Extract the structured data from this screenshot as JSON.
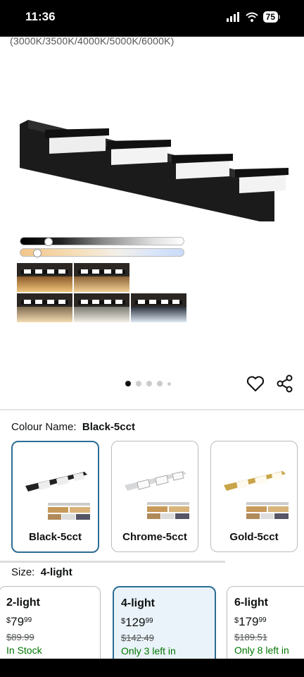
{
  "status": {
    "time": "11:36",
    "battery": "75"
  },
  "product": {
    "spec_text": "(3000K/3500K/4000K/5000K/6000K)"
  },
  "gallery": {
    "total_dots": 5,
    "active_index": 0
  },
  "colour": {
    "label": "Colour Name:",
    "selected": "Black-5cct",
    "options": [
      {
        "name": "Black-5cct"
      },
      {
        "name": "Chrome-5cct"
      },
      {
        "name": "Gold-5cct"
      }
    ]
  },
  "size": {
    "label": "Size:",
    "selected": "4-light",
    "options": [
      {
        "name": "2-light",
        "currency": "$",
        "whole": "79",
        "fraction": "99",
        "was": "$89.99",
        "stock": "In Stock"
      },
      {
        "name": "4-light",
        "currency": "$",
        "whole": "129",
        "fraction": "99",
        "was": "$142.49",
        "stock": "Only 3 left in"
      },
      {
        "name": "6-light",
        "currency": "$",
        "whole": "179",
        "fraction": "99",
        "was": "$189.51",
        "stock": "Only 8 left in"
      }
    ]
  },
  "icons": {
    "wishlist": "heart-icon",
    "share": "share-icon",
    "signal": "signal-icon",
    "wifi": "wifi-icon",
    "battery": "battery-icon"
  }
}
